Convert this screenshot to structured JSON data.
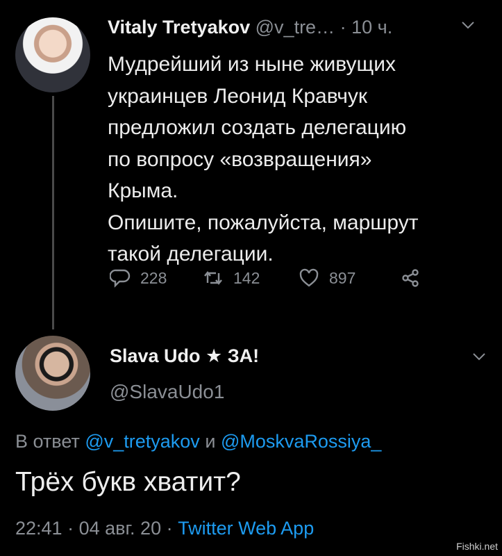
{
  "tweet1": {
    "author_name": "Vitaly Tretyakov",
    "author_handle": "@v_tre…",
    "separator": "·",
    "time": "10 ч.",
    "lines": [
      "Мудрейший из ныне живущих",
      "украинцев Леонид Кравчук",
      "предложил создать делегацию",
      "по вопросу «возвращения»",
      "Крыма.",
      "Опишите, пожалуйста, маршрут",
      "такой делегации."
    ],
    "replies": "228",
    "retweets": "142",
    "likes": "897"
  },
  "tweet2": {
    "author_name": "Slava Udo ★ ЗА!",
    "author_handle": "@SlavaUdo1",
    "reply_prefix": "В ответ",
    "mention1": "@v_tretyakov",
    "reply_and": "и",
    "mention2": "@MoskvaRossiya_",
    "text": "Трёх букв хватит?",
    "time": "22:41",
    "dot": "·",
    "date": "04 авг. 20",
    "source": "Twitter Web App"
  },
  "watermark": "Fishki.net",
  "colors": {
    "background": "#000000",
    "link": "#1d9bf0",
    "muted": "#8b8f95"
  },
  "icons": [
    "reply-icon",
    "retweet-icon",
    "like-icon",
    "share-icon",
    "chevron-down-icon"
  ]
}
